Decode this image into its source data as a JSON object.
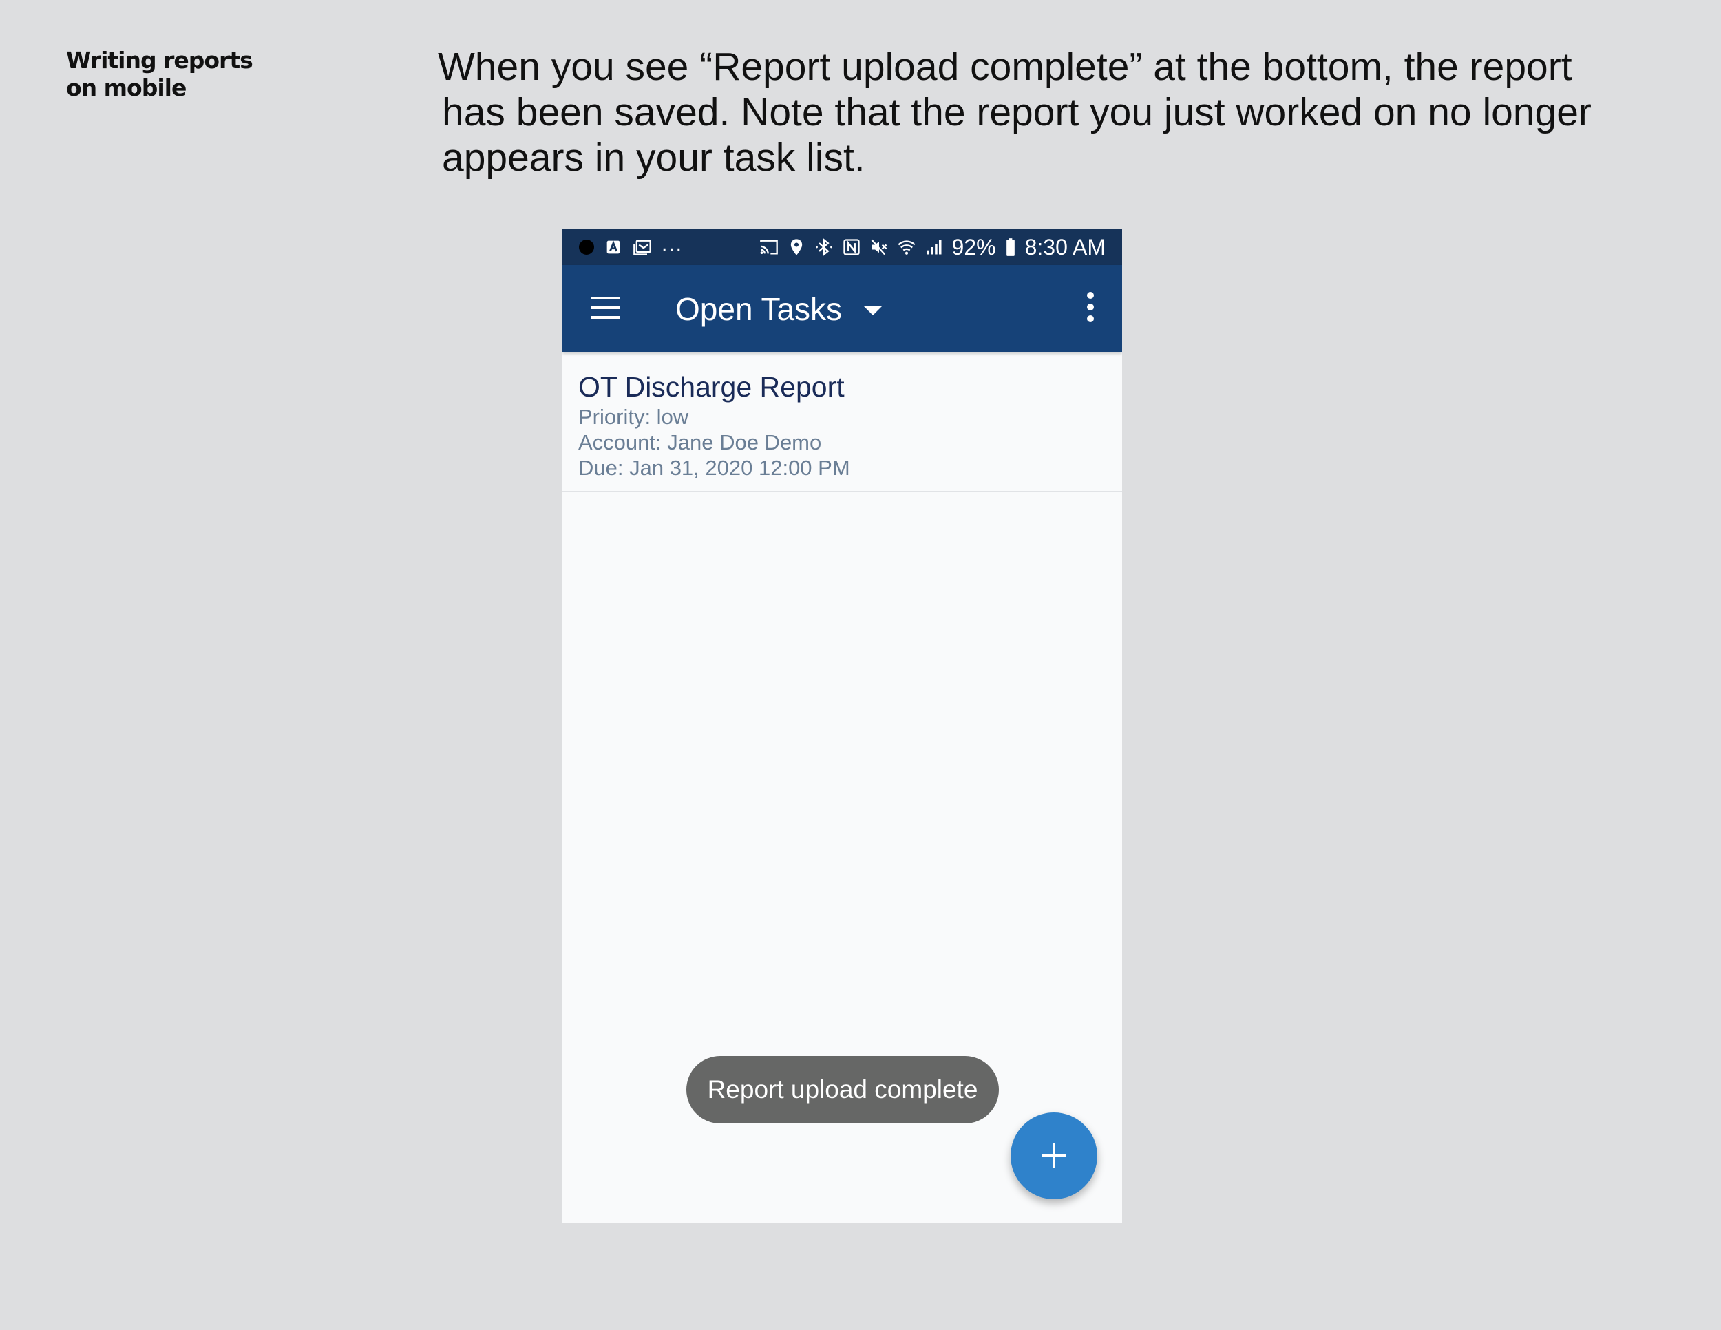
{
  "slide": {
    "section_label_line1": "Writing reports",
    "section_label_line2": "on mobile",
    "instructions_line1": "When you see “Report upload complete” at the bottom, the report",
    "instructions_line2": "has been saved. Note that the report you just worked on no longer",
    "instructions_line3": "appears in your task list."
  },
  "status_bar": {
    "more_indicator": "...",
    "battery": "92%",
    "time": "8:30 AM",
    "icons_left": [
      "notification-dot-icon",
      "app-notification-icon",
      "gallery-notification-icon"
    ],
    "icons_right": [
      "cast-icon",
      "location-icon",
      "bluetooth-icon",
      "nfc-icon",
      "mute-icon",
      "wifi-icon",
      "signal-icon",
      "battery-icon"
    ]
  },
  "app_bar": {
    "title": "Open Tasks",
    "icons": [
      "menu-icon",
      "caret-down-icon",
      "overflow-menu-icon"
    ]
  },
  "tasks": [
    {
      "title": "OT Discharge Report",
      "priority": "Priority: low",
      "account": "Account: Jane Doe Demo",
      "due": "Due: Jan 31, 2020 12:00 PM"
    }
  ],
  "toast": {
    "message": "Report upload complete"
  },
  "fab": {
    "icon": "plus-icon"
  },
  "colors": {
    "page_background": "#dddee0",
    "status_bar": "#163359",
    "app_bar": "#164278",
    "task_title": "#1a2b58",
    "task_meta": "#6a7e95",
    "toast": "#666766",
    "fab": "#2f82cb"
  }
}
